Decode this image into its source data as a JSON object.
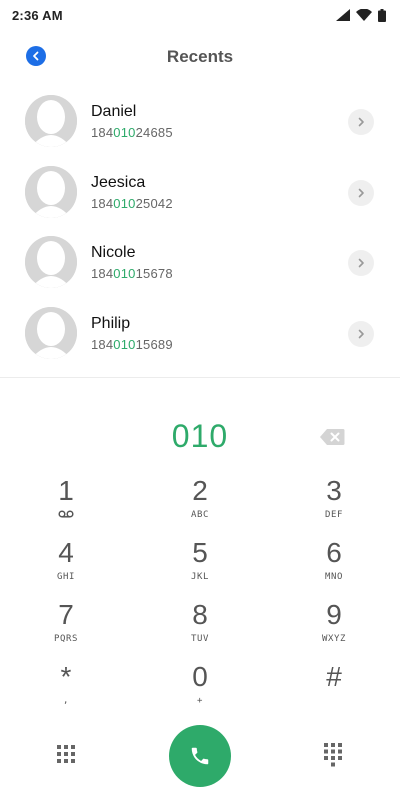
{
  "status_bar": {
    "time": "2:36 AM",
    "icons": [
      "signal-icon",
      "wifi-icon",
      "battery-icon"
    ]
  },
  "header": {
    "title": "Recents",
    "back_icon": "back-arrow-icon"
  },
  "recents": [
    {
      "name": "Daniel",
      "number_prefix": "184",
      "number_match": "010",
      "number_suffix": "24685"
    },
    {
      "name": "Jeesica",
      "number_prefix": "184",
      "number_match": "010",
      "number_suffix": "25042"
    },
    {
      "name": "Nicole",
      "number_prefix": "184",
      "number_match": "010",
      "number_suffix": "15678"
    },
    {
      "name": "Philip",
      "number_prefix": "184",
      "number_match": "010",
      "number_suffix": "15689"
    }
  ],
  "dialer": {
    "value": "010",
    "backspace_icon": "backspace-icon"
  },
  "keypad": [
    {
      "digit": "1",
      "letters": ""
    },
    {
      "digit": "2",
      "letters": "ABC"
    },
    {
      "digit": "3",
      "letters": "DEF"
    },
    {
      "digit": "4",
      "letters": "GHI"
    },
    {
      "digit": "5",
      "letters": "JKL"
    },
    {
      "digit": "6",
      "letters": "MNO"
    },
    {
      "digit": "7",
      "letters": "PQRS"
    },
    {
      "digit": "8",
      "letters": "TUV"
    },
    {
      "digit": "9",
      "letters": "WXYZ"
    },
    {
      "digit": "*",
      "letters": ","
    },
    {
      "digit": "0",
      "letters": "+"
    },
    {
      "digit": "#",
      "letters": ""
    }
  ],
  "bottom_bar": {
    "left_icon": "keypad-grid-icon",
    "call_icon": "phone-icon",
    "right_icon": "dialpad-icon"
  },
  "colors": {
    "accent_green": "#2eaa6a",
    "back_blue": "#1d6ee6",
    "title_gray": "#555555"
  }
}
